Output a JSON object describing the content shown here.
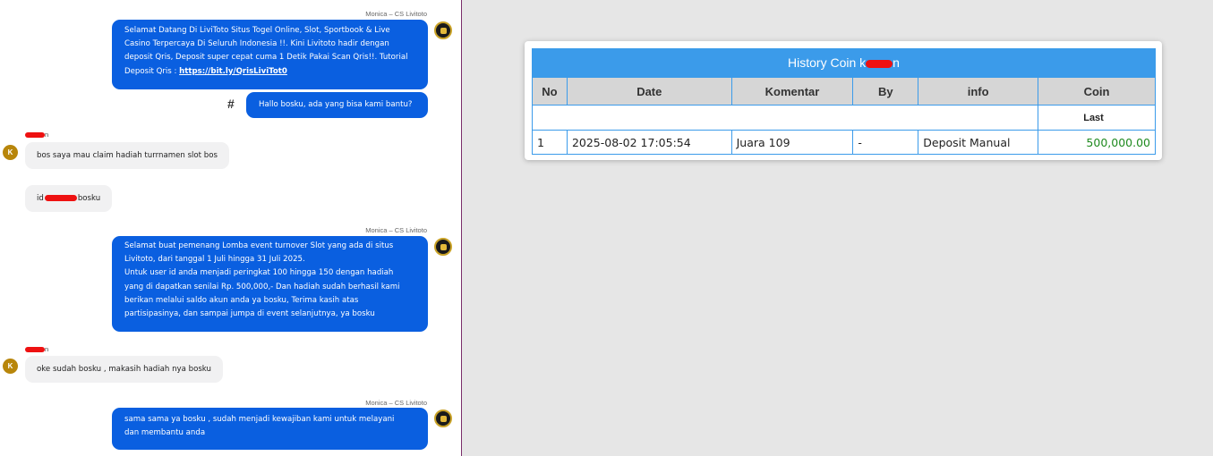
{
  "chat": {
    "messages": [
      {
        "sender": "Monica – CS Livitoto",
        "text_lines": [
          "Selamat Datang Di LiviToto Situs Togel Online, Slot, Sportbook & Live",
          "Casino Terpercaya Di Seluruh Indonesia !!. Kini Livitoto hadir dengan",
          "deposit Qris, Deposit super cepat cuma 1 Detik Pakai Scan Qris!!. Tutorial"
        ],
        "text_last_prefix": "Deposit Qris : ",
        "link": "https://bit.ly/QrisLiviTot0"
      },
      {
        "text": "Hallo bosku, ada yang bisa kami bantu?",
        "marker": "#"
      },
      {
        "sender_initial": "K",
        "sender_name_suffix": "n",
        "text": "bos saya mau claim hadiah turrnamen slot bos"
      },
      {
        "prefix": "id",
        "suffix": "bosku"
      },
      {
        "sender": "Monica – CS Livitoto",
        "text_lines": [
          "Selamat buat pemenang Lomba event turnover Slot yang ada di situs",
          "Livitoto, dari tanggal 1 Juli hingga 31 Juli 2025.",
          "Untuk user id anda menjadi peringkat 100 hingga 150 dengan hadiah",
          "yang di dapatkan senilai Rp. 500,000,- Dan hadiah sudah berhasil kami",
          "berikan melalui saldo akun anda ya bosku, Terima kasih atas",
          "partisipasinya, dan sampai jumpa di event selanjutnya, ya bosku"
        ]
      },
      {
        "sender_initial": "K",
        "sender_name_suffix": "n",
        "text": "oke sudah bosku , makasih hadiah nya bosku"
      },
      {
        "sender": "Monica – CS Livitoto",
        "text_lines": [
          "sama sama ya bosku , sudah menjadi kewajiban kami untuk melayani",
          "dan membantu anda"
        ]
      }
    ]
  },
  "history": {
    "title_prefix": "History Coin k",
    "title_suffix": "n",
    "columns": [
      "No",
      "Date",
      "Komentar",
      "By",
      "info",
      "Coin"
    ],
    "sub_header": "Last",
    "rows": [
      {
        "no": "1",
        "date": "2025-08-02 17:05:54",
        "komentar": "Juara 109",
        "by": "-",
        "info": "Deposit Manual",
        "coin": "500,000.00"
      }
    ],
    "colors": {
      "header": "#3b9bea",
      "coin": "#1f8a1f",
      "agent_bubble": "#0a5fe0",
      "redaction": "#ee1111"
    }
  }
}
